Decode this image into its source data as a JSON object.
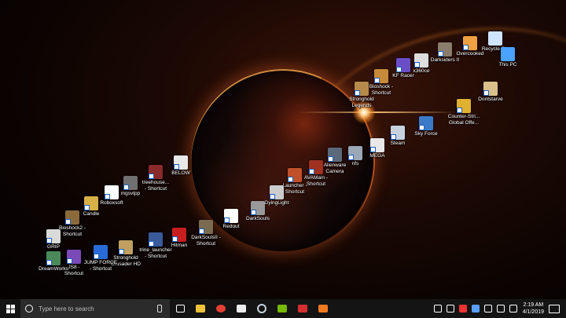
{
  "desktop": {
    "icons": [
      {
        "id": "recycle-bin",
        "label": "Recycle Bin",
        "color": "#cfe4ff",
        "shortcut": false
      },
      {
        "id": "overcooked",
        "label": "Overcooked",
        "color": "#f0a040",
        "shortcut": true
      },
      {
        "id": "darksiders",
        "label": "Darksiders II",
        "color": "#8a7d6b",
        "shortcut": true
      },
      {
        "id": "this-pc",
        "label": "This PC",
        "color": "#4aa3ff",
        "shortcut": false
      },
      {
        "id": "x360ce",
        "label": "x360ce",
        "color": "#dddddd",
        "shortcut": true
      },
      {
        "id": "kf-racer",
        "label": "KF Racer",
        "color": "#6a4ec8",
        "shortcut": true
      },
      {
        "id": "dontstarve",
        "label": "Dontstarve",
        "color": "#d9c08a",
        "shortcut": true
      },
      {
        "id": "bioshock",
        "label": "Bioshock -\nShortcut",
        "color": "#c78a3a",
        "shortcut": true
      },
      {
        "id": "stronghold-legends",
        "label": "Stronghold\nLegends",
        "color": "#b58a4a",
        "shortcut": true
      },
      {
        "id": "counter-strike",
        "label": "Counter-Stri...\nGlobal Offe...",
        "color": "#e0b030",
        "shortcut": true
      },
      {
        "id": "sky-force",
        "label": "Sky Force",
        "color": "#3a7ac8",
        "shortcut": true
      },
      {
        "id": "steam",
        "label": "Steam",
        "color": "#c8d2de",
        "shortcut": true
      },
      {
        "id": "mega",
        "label": "MEGA",
        "color": "#e8e8e8",
        "shortcut": true
      },
      {
        "id": "nfs",
        "label": "nfs",
        "color": "#9aa8b8",
        "shortcut": true
      },
      {
        "id": "alienware-camera",
        "label": "Alienware\nCamera",
        "color": "#5a6a7a",
        "shortcut": true
      },
      {
        "id": "avamain",
        "label": "AVAMain -\nShortcut",
        "color": "#a03020",
        "shortcut": true
      },
      {
        "id": "launcher",
        "label": "Launcher -\nShortcut",
        "color": "#c0502a",
        "shortcut": true
      },
      {
        "id": "dyinglight",
        "label": "DyingLight",
        "color": "#cccccc",
        "shortcut": true
      },
      {
        "id": "darksouls",
        "label": "DarkSouls",
        "color": "#999999",
        "shortcut": true
      },
      {
        "id": "redout",
        "label": "Redout",
        "color": "#ffffff",
        "shortcut": true
      },
      {
        "id": "darksouls2",
        "label": "DarkSoulsII -\nShortcut",
        "color": "#7a6a50",
        "shortcut": true
      },
      {
        "id": "hitman",
        "label": "Hitman",
        "color": "#c81e1e",
        "shortcut": true
      },
      {
        "id": "trine-launcher",
        "label": "trine_launcher\n- Shortcut",
        "color": "#3a5a9a",
        "shortcut": true
      },
      {
        "id": "stronghold-crusader",
        "label": "Stronghold\nCrusader HD",
        "color": "#c0a060",
        "shortcut": true
      },
      {
        "id": "jump-force",
        "label": "JUMP FORCE\n- Shortcut",
        "color": "#2a6ad8",
        "shortcut": true
      },
      {
        "id": "js8",
        "label": "JS8 -\nShortcut",
        "color": "#7a4ab8",
        "shortcut": true
      },
      {
        "id": "dreamworks",
        "label": "DreamWorks",
        "color": "#4a8a5a",
        "shortcut": true
      },
      {
        "id": "grip",
        "label": "GRIP",
        "color": "#dadada",
        "shortcut": true
      },
      {
        "id": "bioshock2",
        "label": "Bioshock2 -\nShortcut",
        "color": "#8a6a3a",
        "shortcut": true
      },
      {
        "id": "candle",
        "label": "Candle",
        "color": "#d8b048",
        "shortcut": true
      },
      {
        "id": "roboxsoft",
        "label": "Roboxsoft",
        "color": "#ffffff",
        "shortcut": true
      },
      {
        "id": "mgsvtpp",
        "label": "mgsvtpp",
        "color": "#707070",
        "shortcut": true
      },
      {
        "id": "treehouse",
        "label": "treehouse...\n- Shortcut",
        "color": "#8a2a2a",
        "shortcut": true
      },
      {
        "id": "below",
        "label": "BELOW",
        "color": "#e8e8e8",
        "shortcut": true
      }
    ]
  },
  "taskbar": {
    "search_placeholder": "Type here to search",
    "pinned": [
      {
        "id": "task-view",
        "color": "#ffffff"
      },
      {
        "id": "file-explorer",
        "color": "#f3c13a"
      },
      {
        "id": "chrome",
        "color": "#e34133"
      },
      {
        "id": "video-editor",
        "color": "#eeeeee"
      },
      {
        "id": "steam-taskbar",
        "color": "#c8d2de"
      },
      {
        "id": "nvidia",
        "color": "#76b900"
      },
      {
        "id": "red-app",
        "color": "#d32f2f"
      },
      {
        "id": "orange-x",
        "color": "#f07a20"
      }
    ],
    "tray": [
      {
        "id": "people",
        "color": "#ffffff"
      },
      {
        "id": "up-chevron",
        "color": "#ffffff"
      },
      {
        "id": "red-x",
        "color": "#e33"
      },
      {
        "id": "antivirus",
        "color": "#5aa0ff"
      },
      {
        "id": "wifi",
        "color": "#ffffff"
      },
      {
        "id": "battery",
        "color": "#ffffff"
      },
      {
        "id": "volume",
        "color": "#ffffff"
      }
    ],
    "time": "2:19 AM",
    "date": "4/1/2019"
  }
}
